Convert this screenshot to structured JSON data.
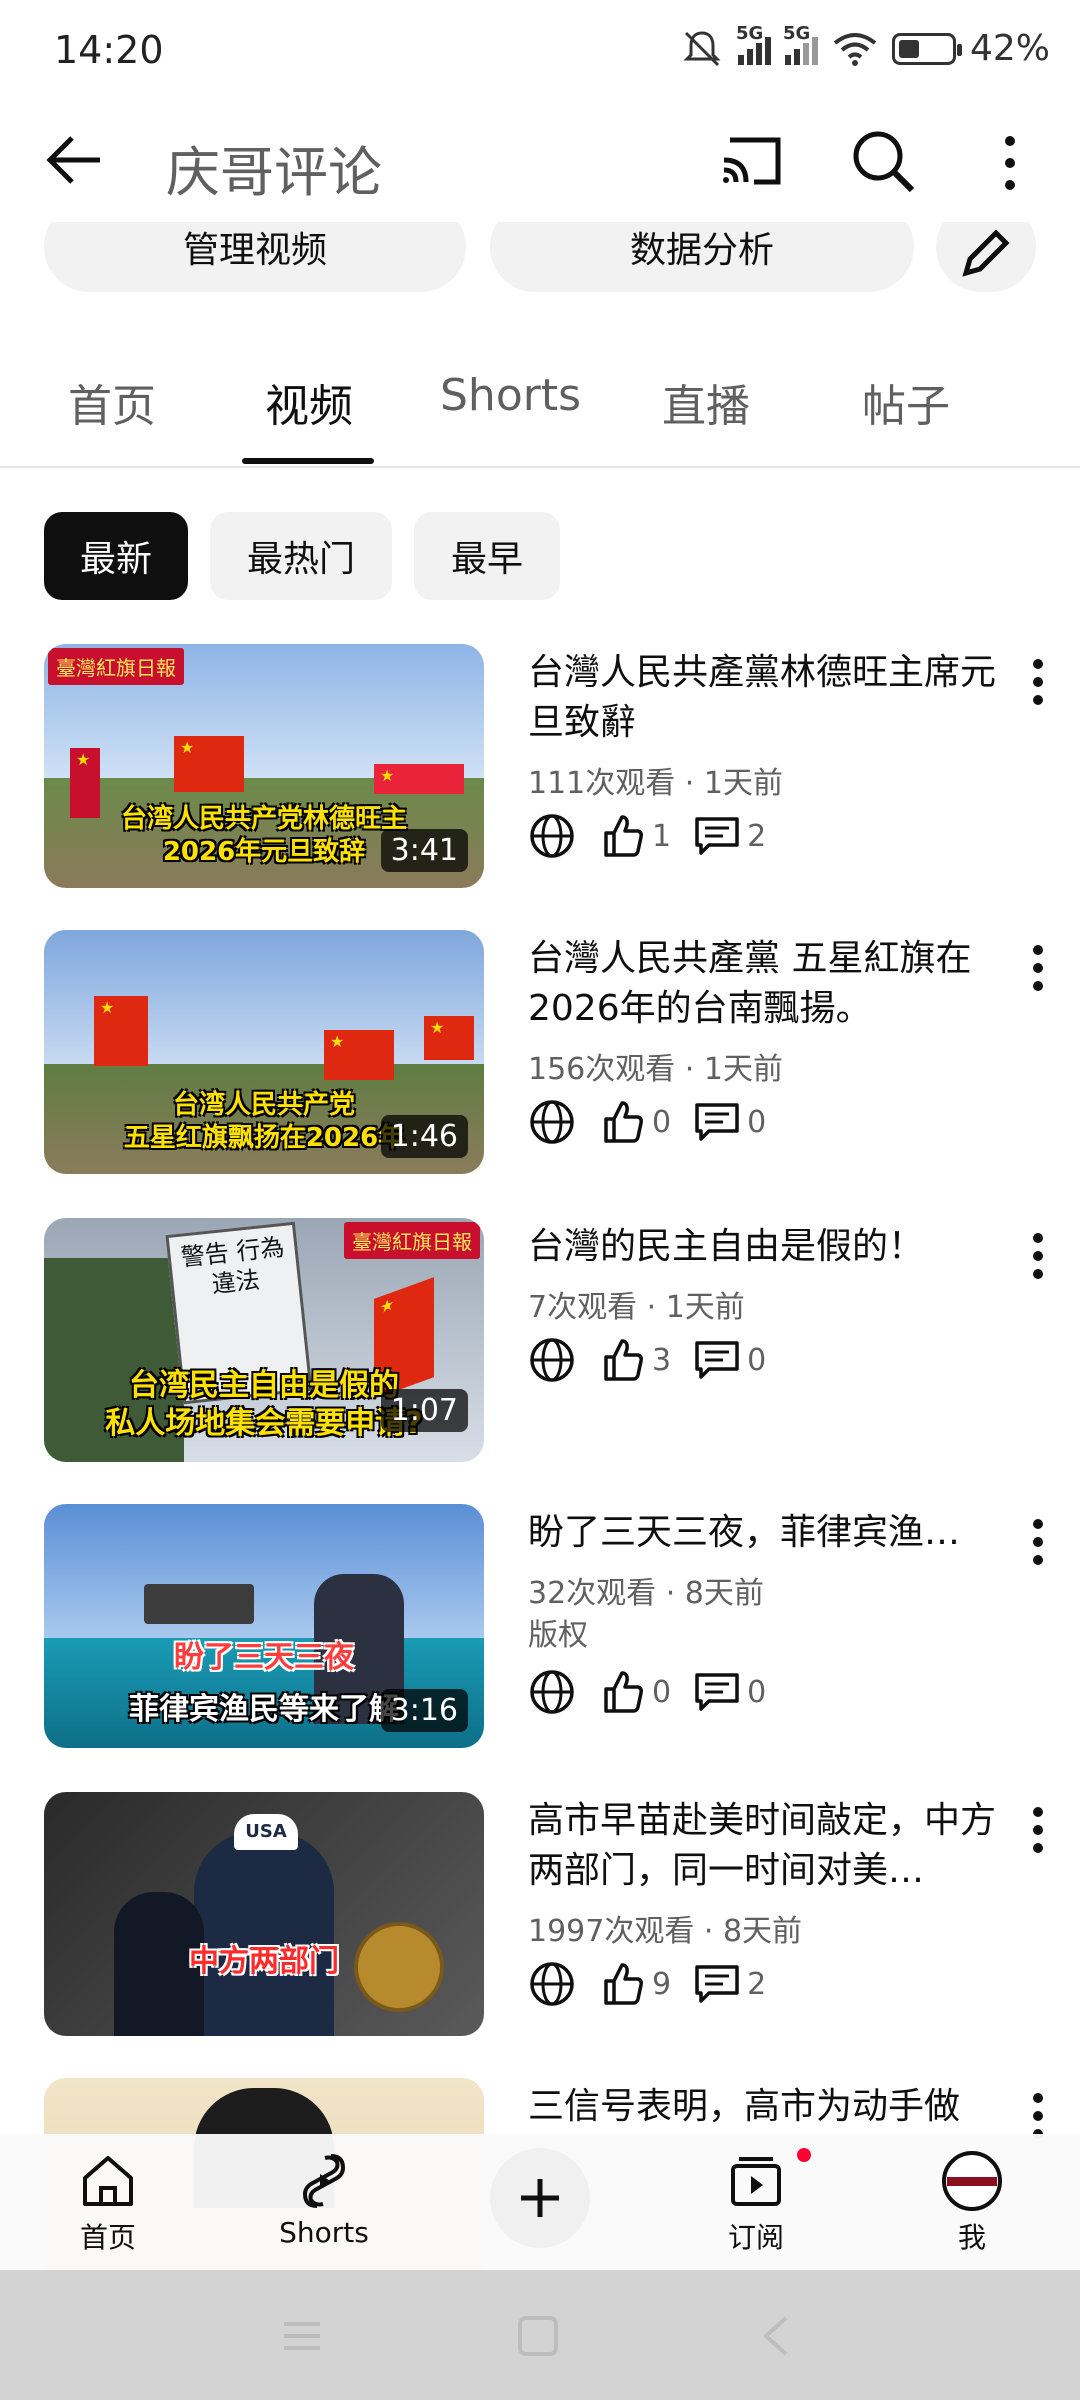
{
  "status_bar": {
    "time": "14:20",
    "net1": "5G",
    "net2": "5G",
    "battery": "42%"
  },
  "header": {
    "title": "庆哥评论"
  },
  "actions": {
    "manage": "管理视频",
    "analytics": "数据分析"
  },
  "tabs": [
    "首页",
    "视频",
    "Shorts",
    "直播",
    "帖子"
  ],
  "active_tab": "视频",
  "chips": [
    "最新",
    "最热门",
    "最早"
  ],
  "videos": [
    {
      "title": "台灣人民共產黨林德旺主席元旦致辭",
      "meta": "111次观看 · 1天前",
      "duration": "3:41",
      "caption": "台湾人民共产党林德旺主\n2026年元旦致辞",
      "badge": "臺灣紅旗日報",
      "likes": "1",
      "comments": "2"
    },
    {
      "title": "台灣人民共產黨 五星紅旗在2026年的台南飄揚。",
      "meta": "156次观看 · 1天前",
      "duration": "1:46",
      "caption": "台湾人民共产党\n五星红旗飘扬在2026年",
      "likes": "0",
      "comments": "0"
    },
    {
      "title": "台灣的民主自由是假的！",
      "meta": "7次观看 · 1天前",
      "duration": "1:07",
      "caption": "台湾民主自由是假的\n私人场地集会需要申请?",
      "badge": "臺灣紅旗日報",
      "sign": "警告 行為違法",
      "likes": "3",
      "comments": "0"
    },
    {
      "title": "盼了三天三夜，菲律宾渔…",
      "meta": "32次观看 · 8天前",
      "extra": "版权",
      "duration": "3:16",
      "caption_red": "盼了三天三夜",
      "caption": "菲律宾渔民等来了解",
      "likes": "0",
      "comments": "0"
    },
    {
      "title": "高市早苗赴美时间敲定，中方两部门，同一时间对美…",
      "meta": "1997次观看 · 8天前",
      "caption_red": "中方两部门",
      "cap_text": "USA",
      "likes": "9",
      "comments": "2"
    },
    {
      "title": "三信号表明，高市为动手做"
    }
  ],
  "bottom_nav": {
    "home": "首页",
    "shorts": "Shorts",
    "subs": "订阅",
    "me": "我"
  },
  "colors": {
    "accent": "#0f0f0f",
    "secondary_text": "#606060",
    "chip_bg": "#f2f2f2",
    "notify": "#ff0033"
  }
}
